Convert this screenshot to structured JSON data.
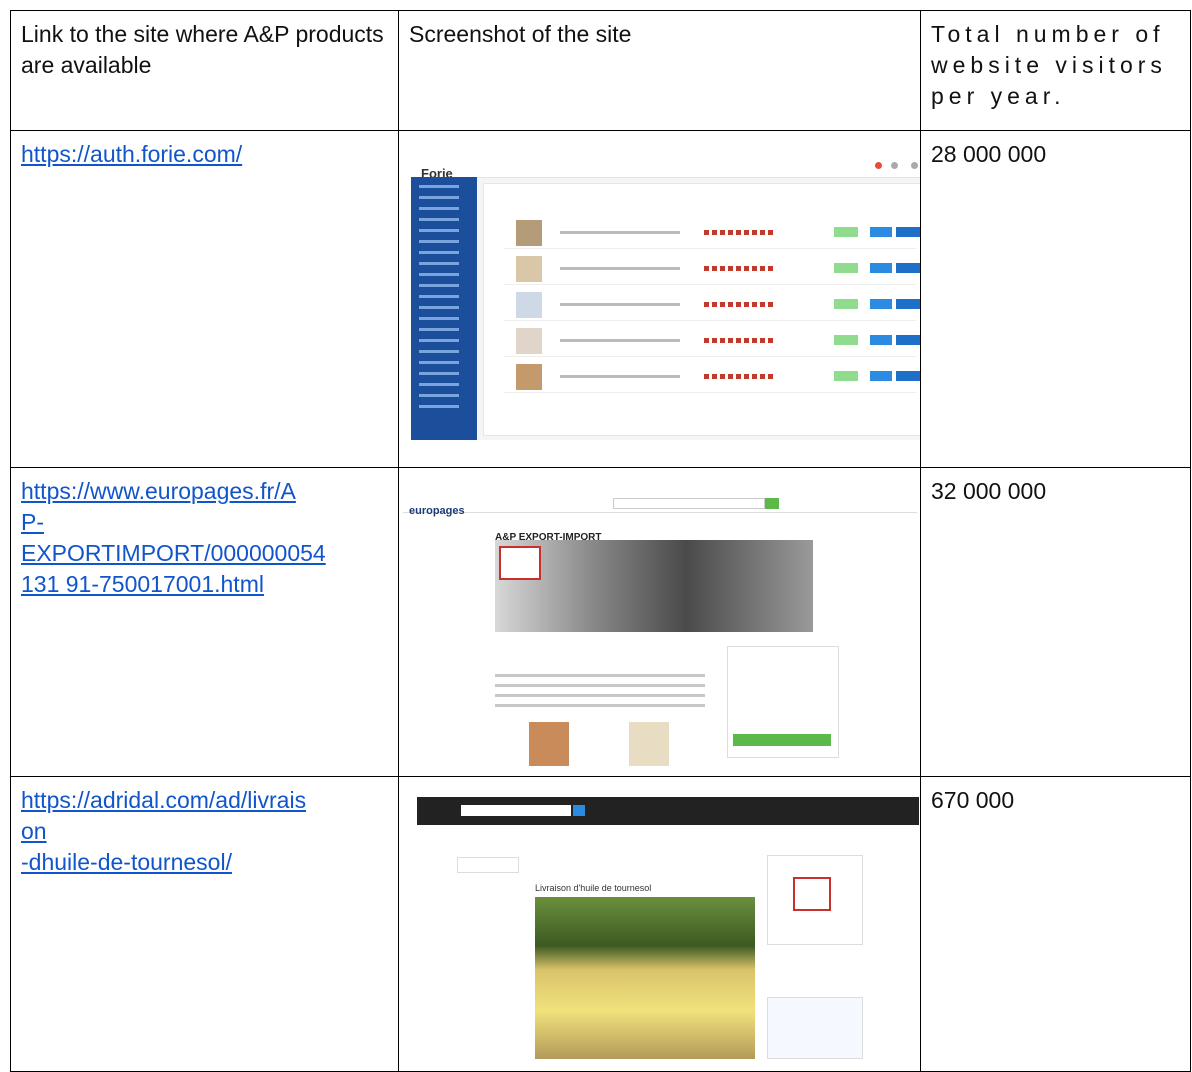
{
  "table": {
    "headers": [
      "Link to the site where A&P products are available",
      "Screenshot of the site",
      "Total number of website visitors per year."
    ],
    "rows": [
      {
        "link_lines": [
          "https://auth.forie.com/"
        ],
        "visitors": "28 000 000",
        "shot": {
          "logo": "Forie"
        }
      },
      {
        "link_lines": [
          "https://www.europages.fr/A",
          "P-",
          "EXPORTIMPORT/000000054",
          "131 91-750017001.html"
        ],
        "visitors": "32 000 000",
        "shot": {
          "logo": "europages",
          "title": "A&P EXPORT-IMPORT"
        }
      },
      {
        "link_lines": [
          "https://adridal.com/ad/livrais",
          "on",
          "-dhuile-de-tournesol/"
        ],
        "visitors": "670 000",
        "shot": {
          "title": "Livraison d'huile de tournesol"
        }
      }
    ]
  },
  "colors": {
    "link": "#1155cc",
    "forie_sidebar": "#1b4f9c",
    "europages_green": "#5db84a",
    "adridal_header": "#222222"
  }
}
